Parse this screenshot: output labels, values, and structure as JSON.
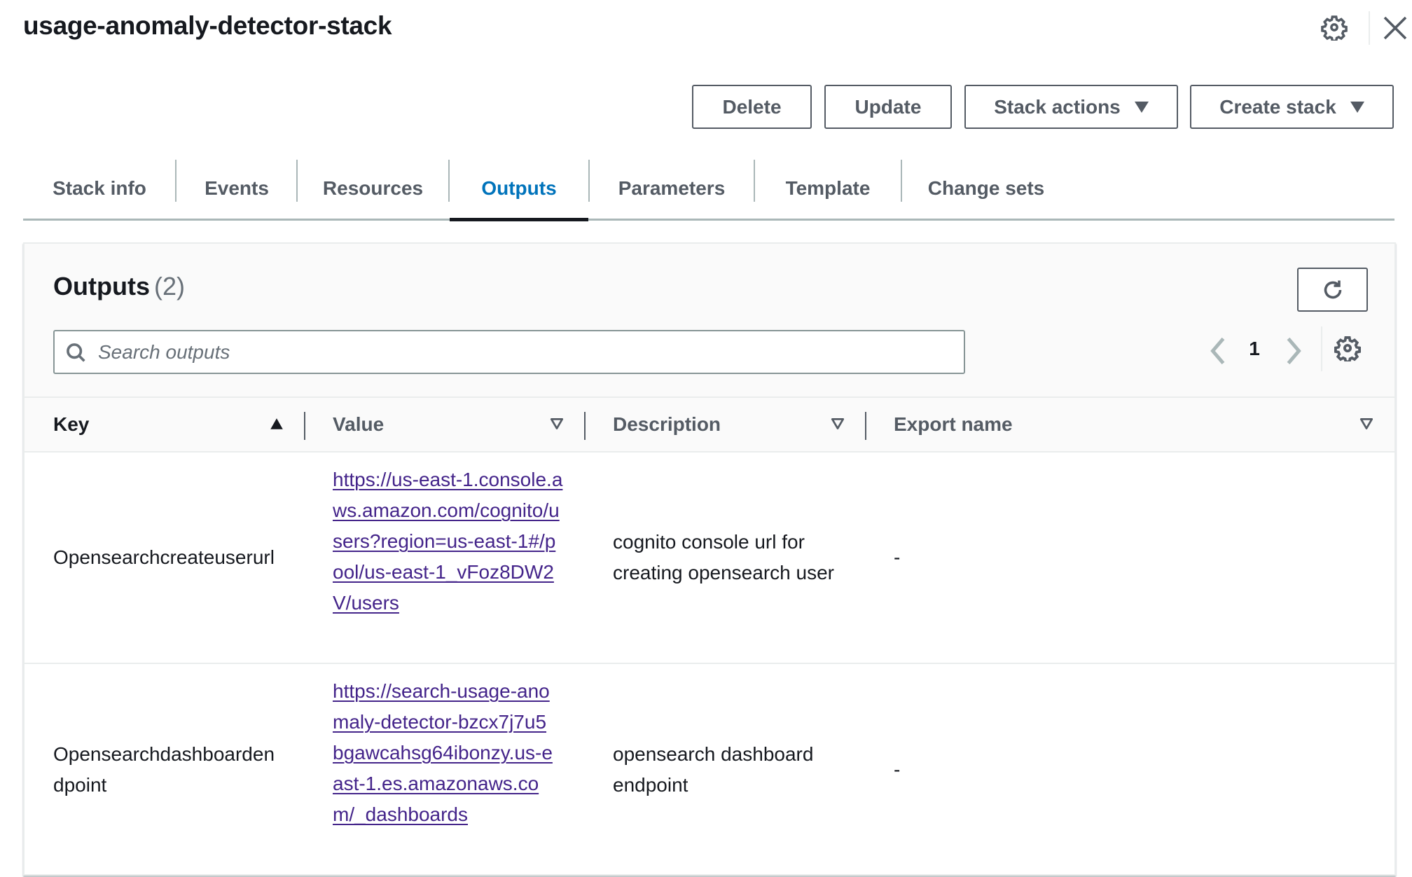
{
  "header": {
    "title": "usage-anomaly-detector-stack",
    "settings_icon": "gear-icon",
    "close_icon": "close-icon"
  },
  "actions": {
    "delete_label": "Delete",
    "update_label": "Update",
    "stack_actions_label": "Stack actions",
    "create_stack_label": "Create stack"
  },
  "tabs": [
    {
      "label": "Stack info",
      "active": false
    },
    {
      "label": "Events",
      "active": false
    },
    {
      "label": "Resources",
      "active": false
    },
    {
      "label": "Outputs",
      "active": true
    },
    {
      "label": "Parameters",
      "active": false
    },
    {
      "label": "Template",
      "active": false
    },
    {
      "label": "Change sets",
      "active": false
    }
  ],
  "outputs": {
    "title": "Outputs",
    "count": "(2)",
    "search": {
      "placeholder": "Search outputs",
      "value": ""
    },
    "pagination": {
      "current_page": "1"
    },
    "columns": [
      {
        "label": "Key",
        "sort": "ascending"
      },
      {
        "label": "Value",
        "sort": "none"
      },
      {
        "label": "Description",
        "sort": "none"
      },
      {
        "label": "Export name",
        "sort": "none"
      }
    ],
    "rows": [
      {
        "key": "Opensearchcreateuserurl",
        "value": "https://us-east-1.console.aws.amazon.com/cognito/users?region=us-east-1#/pool/us-east-1_vFoz8DW2V/users",
        "description": "cognito console url for creating opensearch user",
        "export_name": "-"
      },
      {
        "key": "Opensearchdashboardendpoint",
        "value": "https://search-usage-anomaly-detector-bzcx7j7u5bgawcahsg64ibonzy.us-east-1.es.amazonaws.com/_dashboards",
        "description": "opensearch dashboard endpoint",
        "export_name": "-"
      }
    ]
  },
  "colors": {
    "text_primary": "#16191f",
    "text_secondary": "#545b64",
    "tab_active": "#0073bb",
    "link": "#44248a",
    "border": "#eaeded"
  }
}
